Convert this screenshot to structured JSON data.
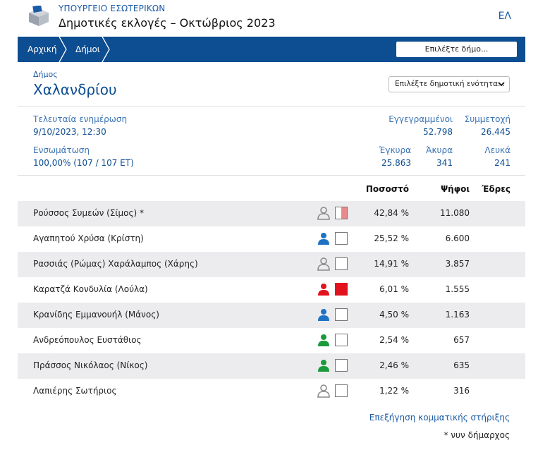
{
  "header": {
    "ministry": "ΥΠΟΥΡΓΕΙΟ ΕΣΩΤΕΡΙΚΩΝ",
    "election": "Δημοτικές εκλογές – Οκτώβριος 2023",
    "language": "ΕΛ"
  },
  "nav": {
    "home": "Αρχική",
    "municipalities": "Δήμοι",
    "select_municipality": "Επιλέξτε δήμο..."
  },
  "municipality": {
    "label": "Δήμος",
    "name": "Χαλανδρίου",
    "unit_select": "Επιλέξτε δημοτική ενότητα..."
  },
  "stats": {
    "last_update_label": "Τελευταία ενημέρωση",
    "last_update_value": "9/10/2023, 12:30",
    "integration_label": "Ενσωμάτωση",
    "integration_value": "100,00% (107 / 107 ΕΤ)",
    "registered_label": "Εγγεγραμμένοι",
    "registered_value": "52.798",
    "turnout_label": "Συμμετοχή",
    "turnout_value": "26.445",
    "valid_label": "Έγκυρα",
    "valid_value": "25.863",
    "invalid_label": "Άκυρα",
    "invalid_value": "341",
    "blank_label": "Λευκά",
    "blank_value": "241"
  },
  "table": {
    "headers": {
      "percent": "Ποσοστό",
      "votes": "Ψήφοι",
      "seats": "Έδρες"
    },
    "rows": [
      {
        "name": "Ρούσσος Συμεών (Σίμος) *",
        "percent": "42,84 %",
        "votes": "11.080",
        "seats": "",
        "icon": "person-gray-icon",
        "person_color": "#8a8a8a",
        "party": "half-red"
      },
      {
        "name": "Αγαπητού Χρύσα (Κρίστη)",
        "percent": "25,52 %",
        "votes": "6.600",
        "seats": "",
        "icon": "person-blue-icon",
        "person_color": "#1d72c4",
        "party": "none"
      },
      {
        "name": "Ρασσιάς (Ρώμας) Χαράλαμπος (Χάρης)",
        "percent": "14,91 %",
        "votes": "3.857",
        "seats": "",
        "icon": "person-gray-icon",
        "person_color": "#8a8a8a",
        "party": "none"
      },
      {
        "name": "Καρατζά Κονδυλία (Λούλα)",
        "percent": "6,01 %",
        "votes": "1.555",
        "seats": "",
        "icon": "person-red-icon",
        "person_color": "#e2131d",
        "party": "red"
      },
      {
        "name": "Κρανίδης Εμμανουήλ (Μάνος)",
        "percent": "4,50 %",
        "votes": "1.163",
        "seats": "",
        "icon": "person-blue-icon",
        "person_color": "#1d72c4",
        "party": "none"
      },
      {
        "name": "Ανδρεόπουλος Ευστάθιος",
        "percent": "2,54 %",
        "votes": "657",
        "seats": "",
        "icon": "person-green-icon",
        "person_color": "#1a9a3a",
        "party": "none"
      },
      {
        "name": "Πράσσος Νικόλαος (Νίκος)",
        "percent": "2,46 %",
        "votes": "635",
        "seats": "",
        "icon": "person-green-icon",
        "person_color": "#1a9a3a",
        "party": "none"
      },
      {
        "name": "Λαπιέρης Σωτήριος",
        "percent": "1,22 %",
        "votes": "316",
        "seats": "",
        "icon": "person-gray-icon",
        "person_color": "#8a8a8a",
        "party": "none"
      }
    ]
  },
  "footer": {
    "explanation_link": "Επεξήγηση κομματικής στήριξης",
    "mayor_note": "* νυν δήμαρχος"
  },
  "colors": {
    "nav_bg": "#0d4d92",
    "accent": "#1a5aa6",
    "row_alt": "#ececee"
  }
}
